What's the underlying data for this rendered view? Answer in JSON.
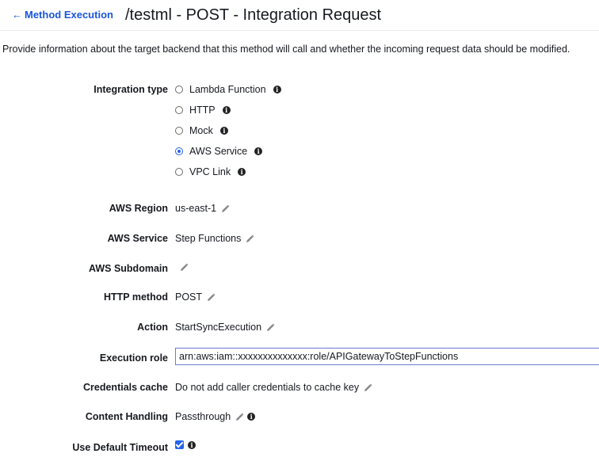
{
  "header": {
    "back_link": "Method Execution",
    "title": "/testml - POST - Integration Request"
  },
  "description": "Provide information about the target backend that this method will call and whether the incoming request data should be modified.",
  "integration_type": {
    "label": "Integration type",
    "options": [
      "Lambda Function",
      "HTTP",
      "Mock",
      "AWS Service",
      "VPC Link"
    ],
    "selected": "AWS Service"
  },
  "fields": {
    "aws_region": {
      "label": "AWS Region",
      "value": "us-east-1"
    },
    "aws_service": {
      "label": "AWS Service",
      "value": "Step Functions"
    },
    "aws_subdomain": {
      "label": "AWS Subdomain",
      "value": ""
    },
    "http_method": {
      "label": "HTTP method",
      "value": "POST"
    },
    "action": {
      "label": "Action",
      "value": "StartSyncExecution"
    },
    "execution_role": {
      "label": "Execution role",
      "value": "arn:aws:iam::xxxxxxxxxxxxxx:role/APIGatewayToStepFunctions"
    },
    "credentials_cache": {
      "label": "Credentials cache",
      "value": "Do not add caller credentials to cache key"
    },
    "content_handling": {
      "label": "Content Handling",
      "value": "Passthrough"
    },
    "use_default_timeout": {
      "label": "Use Default Timeout",
      "checked": true
    }
  },
  "colors": {
    "link": "#1a56db",
    "accent": "#2563eb"
  }
}
